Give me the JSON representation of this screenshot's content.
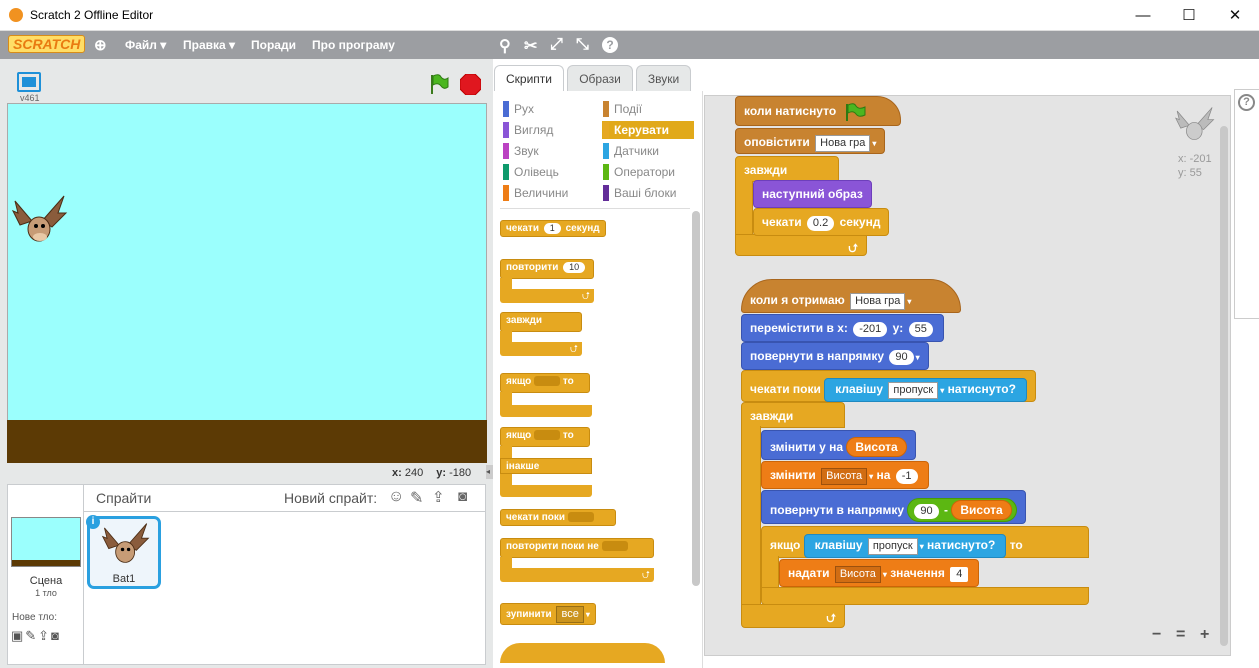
{
  "window": {
    "title": "Scratch 2 Offline Editor",
    "minimize": "—",
    "maximize": "☐",
    "close": "✕"
  },
  "menubar": {
    "logo": "SCRATCH",
    "file": "Файл ▾",
    "edit": "Правка ▾",
    "tips": "Поради",
    "about": "Про програму"
  },
  "stage": {
    "version": "v461",
    "x_label": "x:",
    "x_value": "240",
    "y_label": "y:",
    "y_value": "-180"
  },
  "sprites": {
    "title": "Спрайти",
    "new_sprite": "Новий спрайт:",
    "stage_name": "Сцена",
    "stage_backdrops": "1 тло",
    "new_backdrop": "Нове тло:",
    "sprite_name": "Bat1"
  },
  "tabs": [
    "Скрипти",
    "Образи",
    "Звуки"
  ],
  "categories": {
    "left": [
      "Рух",
      "Вигляд",
      "Звук",
      "Олівець",
      "Величини"
    ],
    "right": [
      "Події",
      "Керувати",
      "Датчики",
      "Оператори",
      "Ваші блоки"
    ],
    "left_colors": [
      "#4a6cd4",
      "#8a55d7",
      "#bb42c3",
      "#0e9a6c",
      "#ee7d16"
    ],
    "right_colors": [
      "#c88330",
      "#e6a822",
      "#2ca5e2",
      "#5cb712",
      "#632d99"
    ]
  },
  "palette": {
    "wait": "чекати",
    "wait_val": "1",
    "wait_unit": "секунд",
    "repeat": "повторити",
    "repeat_val": "10",
    "forever": "завжди",
    "if": "якщо",
    "then": "то",
    "else": "інакше",
    "wait_until": "чекати поки",
    "repeat_until": "повторити поки не",
    "stop": "зупинити",
    "stop_val": "все"
  },
  "script1": {
    "hat": "коли натиснуто",
    "broadcast": "оповістити",
    "broadcast_val": "Нова гра",
    "forever": "завжди",
    "next_costume": "наступний образ",
    "wait": "чекати",
    "wait_val": "0.2",
    "wait_unit": "секунд"
  },
  "script2": {
    "hat": "коли я отримаю",
    "hat_val": "Нова гра",
    "goto": "перемістити в x:",
    "goto_x": "-201",
    "goto_y_label": "y:",
    "goto_y": "55",
    "point": "повернути в напрямку",
    "point_val": "90",
    "wait_until": "чекати поки",
    "key": "клавішу",
    "key_val": "пропуск",
    "pressed": "натиснуто?",
    "forever": "завжди",
    "change_y": "змінити у на",
    "var": "Висота",
    "change_var": "змінити",
    "change_var_val": "Висота",
    "by": "на",
    "by_val": "-1",
    "point2": "повернути в напрямку",
    "num90": "90",
    "minus": "-",
    "if": "якщо",
    "then": "то",
    "set": "надати",
    "set_var": "Висота",
    "value": "значення",
    "set_val": "4"
  },
  "sprite_info": {
    "x": "x: -201",
    "y": "y: 55"
  },
  "zoom": {
    "out": "−",
    "reset": "=",
    "in": "+"
  }
}
